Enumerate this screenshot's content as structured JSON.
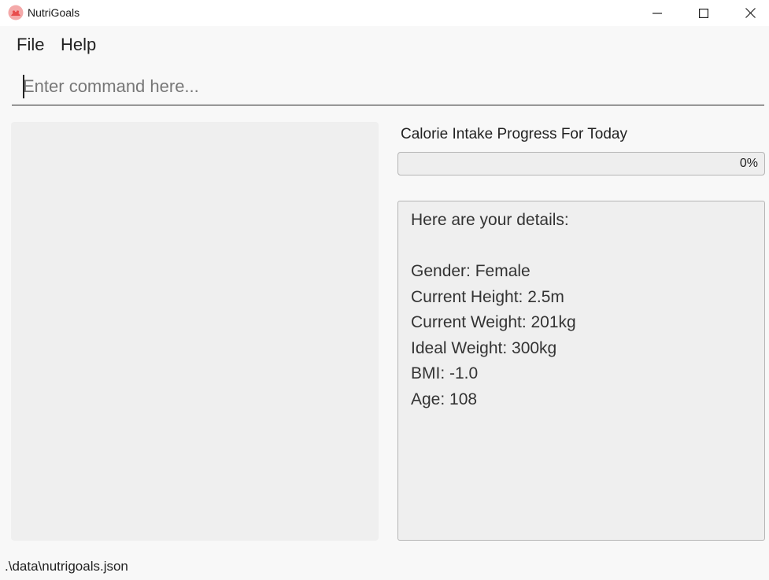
{
  "window": {
    "title": "NutriGoals",
    "controls": [
      "minimize",
      "maximize",
      "close"
    ]
  },
  "menu": {
    "items": [
      {
        "label": "File"
      },
      {
        "label": "Help"
      }
    ]
  },
  "command": {
    "placeholder": "Enter command here...",
    "value": ""
  },
  "progress": {
    "title": "Calorie Intake Progress For Today",
    "value_text": "0%",
    "fraction": 0
  },
  "details": {
    "header": "Here are your details:",
    "gender": "Gender: Female",
    "height": "Current Height: 2.5m",
    "weight": "Current Weight: 201kg",
    "ideal_weight": "Ideal Weight: 300kg",
    "bmi": "BMI: -1.0",
    "age": "Age: 108"
  },
  "status": {
    "path": ".\\data\\nutrigoals.json"
  },
  "colors": {
    "app_icon": "#ef5f5f",
    "background": "#f8f8f8",
    "panel": "#efefef"
  }
}
